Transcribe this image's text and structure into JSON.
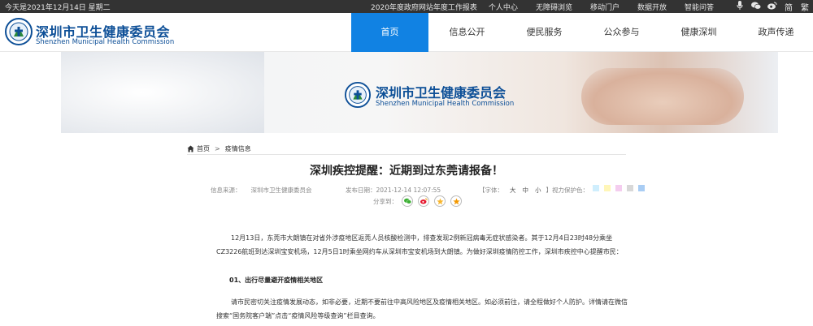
{
  "topbar": {
    "date": "今天是2021年12月14日 星期二",
    "links": [
      "2020年度政府网站年度工作报表",
      "个人中心",
      "无障碍浏览",
      "移动门户",
      "数据开放",
      "智能问答"
    ],
    "icons": [
      "microphone-icon",
      "wechat-icon",
      "weibo-icon"
    ],
    "lang_simplified": "简",
    "lang_traditional": "繁"
  },
  "header": {
    "brand_cn": "深圳市卫生健康委员会",
    "brand_en": "Shenzhen Municipal Health Commission",
    "nav": [
      "首页",
      "信息公开",
      "便民服务",
      "公众参与",
      "健康深圳",
      "政声传递"
    ],
    "active_nav": 0,
    "accent_color": "#1182e3"
  },
  "banner": {
    "brand_cn": "深圳市卫生健康委员会",
    "brand_en": "Shenzhen Municipal Health Commission"
  },
  "breadcrumb": {
    "home": "首页",
    "separator": ">",
    "current": "疫情信息"
  },
  "article": {
    "title": "深圳疾控提醒：近期到过东莞请报备！",
    "source_label": "信息来源：",
    "source": "深圳市卫生健康委员会",
    "date_label": "发布日期：",
    "date": "2021-12-14 12:07:55",
    "fontsize_label": "【字体：",
    "fontsize_options": [
      "大",
      "中",
      "小"
    ],
    "fontsize_close": "】",
    "vision_label": "视力保护色：",
    "vision_colors": [
      "#cfeefd",
      "#fff6b8",
      "#f4cdef",
      "#d8d8d8",
      "#a9cdf4"
    ],
    "share_label": "分享到：",
    "share_icons": [
      "wechat-icon",
      "weibo-icon",
      "qzone-icon",
      "favorite-icon"
    ],
    "paragraph1": "12月13日，东莞市大朗镇在对省外涉疫地区返莞人员核酸检测中，排查发现2例新冠病毒无症状感染者。其于12月4日23时48分乘坐CZ3226航班到达深圳宝安机场，12月5日1时乘坐网约车从深圳市宝安机场到大朗镇。为做好深圳疫情防控工作，深圳市疾控中心提醒市民：",
    "heading1": "01、出行尽量避开疫情相关地区",
    "paragraph2": "请市民密切关注疫情发展动态，如非必要，近期不要前往中高风险地区及疫情相关地区。如必须前往，请全程做好个人防护。详情请在微信搜索“国务院客户端”点击“疫情风险等级查询”栏目查询。"
  }
}
